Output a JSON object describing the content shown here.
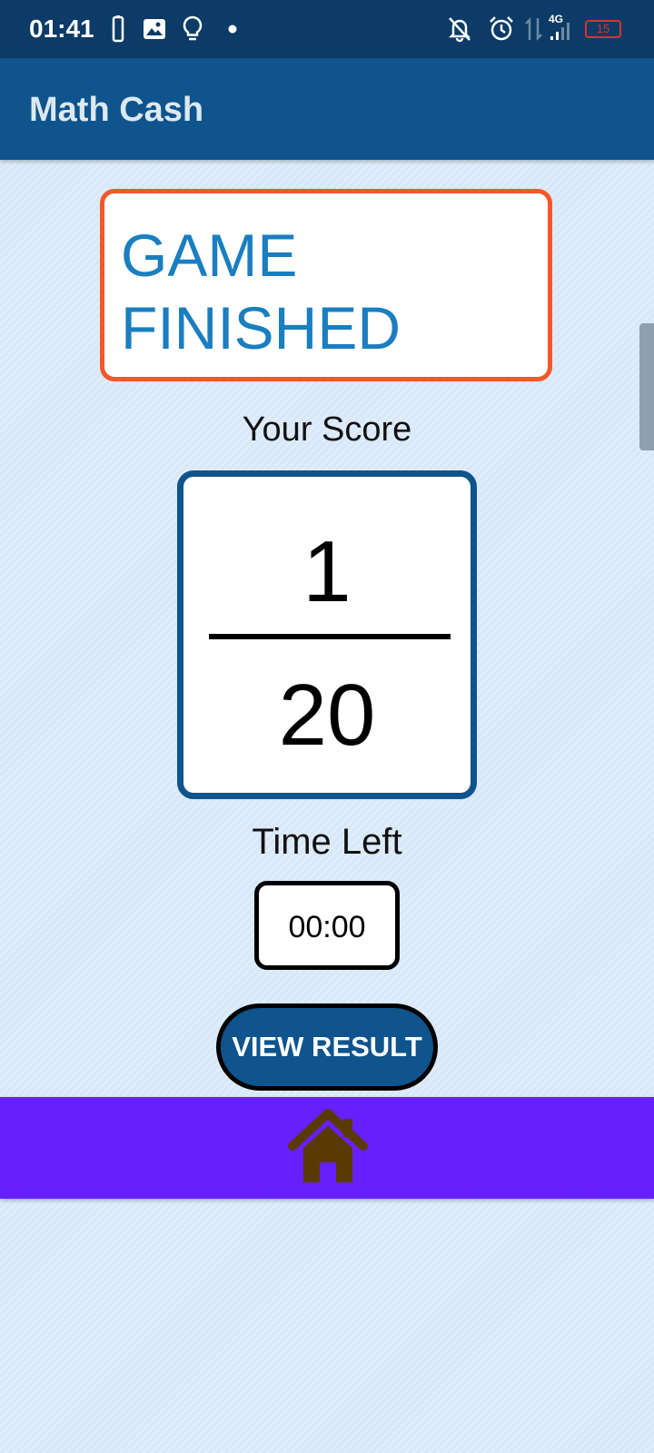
{
  "status_bar": {
    "time": "01:41",
    "network_label": "4G",
    "battery_level": "15",
    "icons": [
      "battery-icon",
      "image-icon",
      "bulb-icon",
      "dot-icon",
      "bell-off-icon",
      "alarm-icon",
      "data-arrows-icon",
      "signal-icon",
      "battery-low-icon"
    ]
  },
  "app_bar": {
    "title": "Math Cash"
  },
  "result": {
    "heading": "GAME FINISHED",
    "score_label": "Your Score",
    "score": "1",
    "total": "20",
    "time_label": "Time Left",
    "time_left": "00:00",
    "view_result_label": "VIEW RESULT"
  },
  "bottom_nav": {
    "home_icon": "home-icon"
  },
  "colors": {
    "status_bar": "#0b3b66",
    "app_bar": "#0f548c",
    "background": "#d8e8f8",
    "finished_border": "#f4572a",
    "finished_text": "#1a7ec0",
    "score_border": "#0f548c",
    "button": "#0f548c",
    "bottom_nav": "#6520fc",
    "home_icon": "#5a3a00",
    "battery_low": "#e0302a"
  }
}
